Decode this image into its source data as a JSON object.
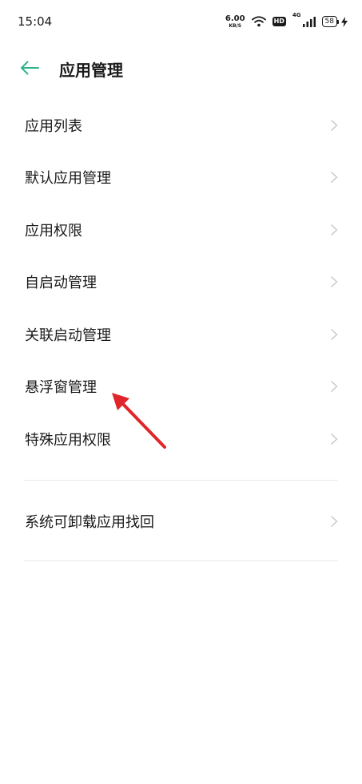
{
  "status_bar": {
    "time": "15:04",
    "net_speed_value": "6.00",
    "net_speed_unit": "KB/S",
    "hd_label": "HD",
    "network_type": "4G",
    "battery_level": "58"
  },
  "header": {
    "title": "应用管理"
  },
  "menu": {
    "items": [
      {
        "label": "应用列表"
      },
      {
        "label": "默认应用管理"
      },
      {
        "label": "应用权限"
      },
      {
        "label": "自启动管理"
      },
      {
        "label": "关联启动管理"
      },
      {
        "label": "悬浮窗管理"
      },
      {
        "label": "特殊应用权限"
      }
    ],
    "secondary_items": [
      {
        "label": "系统可卸载应用找回"
      }
    ]
  },
  "colors": {
    "accent": "#2bb48c",
    "annotation_arrow": "#e0262a"
  }
}
